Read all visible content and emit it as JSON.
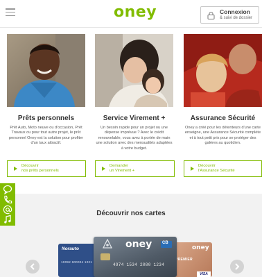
{
  "header": {
    "logo": "oney",
    "login_title": "Connexion",
    "login_subtitle": "& suivi de dossier"
  },
  "products": [
    {
      "title": "Prêts personnels",
      "description": "Prêt Auto, Moto neuve ou d'occasion, Prêt Travaux ou pour tout autre projet, le prêt personnel Oney est la solution pour profiter d'un taux attractif.",
      "cta_line1": "Découvrir",
      "cta_line2": "nos prêts personnels"
    },
    {
      "title": "Service Virement +",
      "description": "Un besoin rapide pour un projet ou une dépense imprévue ? Avec le crédit renouvelable, vous avez à portée de main une solution avec des mensualités adaptées à votre budget.",
      "cta_line1": "Demander",
      "cta_line2": "un Virement +"
    },
    {
      "title": "Assurance Sécurité",
      "description": "Oney a créé pour les détenteurs d'une carte enseigne, une Assurance Sécurité complète et à tout petit prix pour se protéger des galères au quotidien.",
      "cta_line1": "Découvrir",
      "cta_line2": "l'Assurance Sécurité"
    }
  ],
  "cards_section": {
    "title": "Découvrir nos cartes",
    "norauto_brand": "Norauto",
    "norauto_number": "10092  600004  1021",
    "oney_card_brand": "oney",
    "oney_card_network": "CB",
    "oney_card_number": "4974 1534 2080 1234",
    "premier_brand": "oney",
    "premier_label": "PREMIER",
    "premier_network": "VISA"
  },
  "colors": {
    "brand_green": "#81bc00",
    "section_bg": "#f2f2f2"
  },
  "icons": [
    "menu-icon",
    "lock-icon",
    "chat-icon",
    "phone-icon",
    "at-icon",
    "arrow-icon",
    "chevron-left-icon",
    "chevron-right-icon"
  ]
}
